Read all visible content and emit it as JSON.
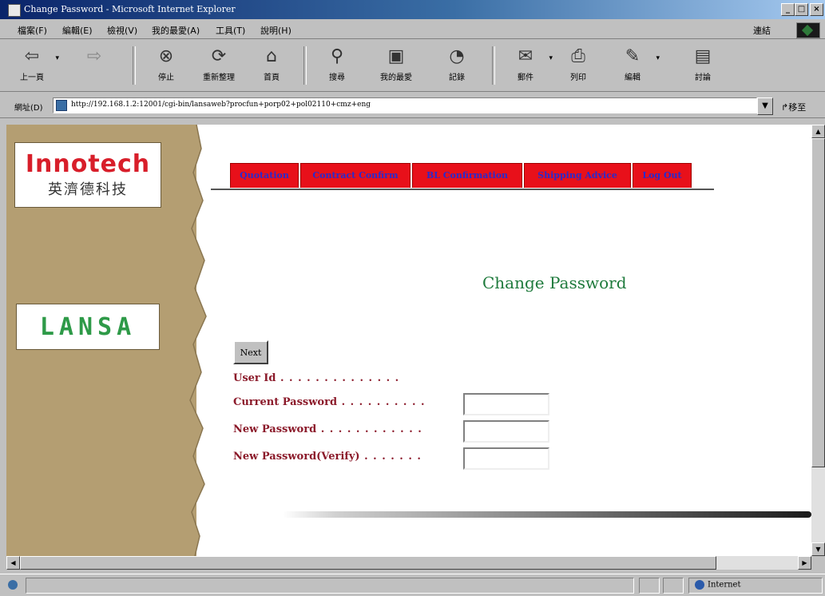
{
  "window": {
    "title": "Change Password - Microsoft Internet Explorer"
  },
  "menu": {
    "items": [
      "檔案(F)",
      "編輯(E)",
      "檢視(V)",
      "我的最愛(A)",
      "工具(T)",
      "說明(H)"
    ],
    "links_label": "連結"
  },
  "toolbar": {
    "back": "上一頁",
    "stop": "停止",
    "refresh": "重新整理",
    "home": "首頁",
    "search": "搜尋",
    "favorites": "我的最愛",
    "history": "記錄",
    "mail": "郵件",
    "print": "列印",
    "edit": "編輯",
    "discuss": "討論"
  },
  "address": {
    "label": "網址(D)",
    "url": "http://192.168.1.2:12001/cgi-bin/lansaweb?procfun+porp02+pol02110+cmz+eng",
    "go_label": "移至"
  },
  "sidebar": {
    "logo_en": "Innotech",
    "logo_zh": "英濟德科技",
    "lansa": "LANSA"
  },
  "nav": {
    "tabs": [
      "Quotation",
      "Contract Confirm",
      "BL Confirmation",
      "Shipping Advice",
      "Log Out"
    ]
  },
  "page": {
    "heading": "Change Password",
    "next_label": "Next"
  },
  "form": {
    "user_id_label": "User Id",
    "user_id_dots": " . . . . . . . . . . . . . .",
    "current_label": "Current Password",
    "current_dots": " . . . . . . . . . .",
    "new_label": "New Password",
    "new_dots": " . . . . . . . . . . . .",
    "verify_label": "New Password(Verify)",
    "verify_dots": " . . . . . . ."
  },
  "status": {
    "zone": "Internet"
  }
}
